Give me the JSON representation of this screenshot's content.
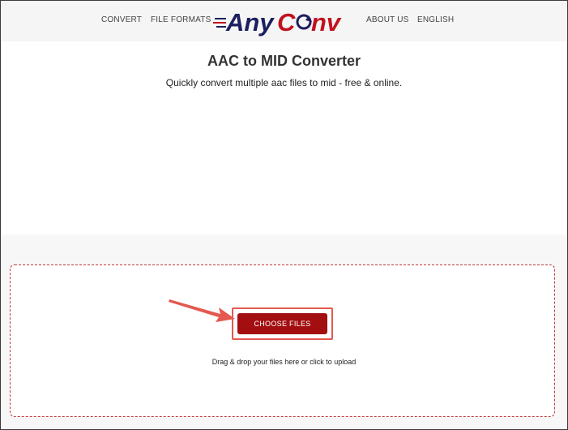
{
  "nav": {
    "convert": "CONVERT",
    "file_formats": "FILE FORMATS",
    "about_us": "ABOUT US",
    "language": "ENGLISH"
  },
  "logo": {
    "part1": "Any",
    "part2": "C",
    "part3": "nv"
  },
  "hero": {
    "title": "AAC to MID Converter",
    "subtitle": "Quickly convert multiple aac files to mid - free & online."
  },
  "upload": {
    "button_label": "CHOOSE FILES",
    "hint": "Drag & drop your files here or click to upload"
  },
  "colors": {
    "accent": "#a30f11",
    "logo_navy": "#1c1f5f",
    "logo_red": "#c1121f",
    "annotation": "#e4584f"
  }
}
